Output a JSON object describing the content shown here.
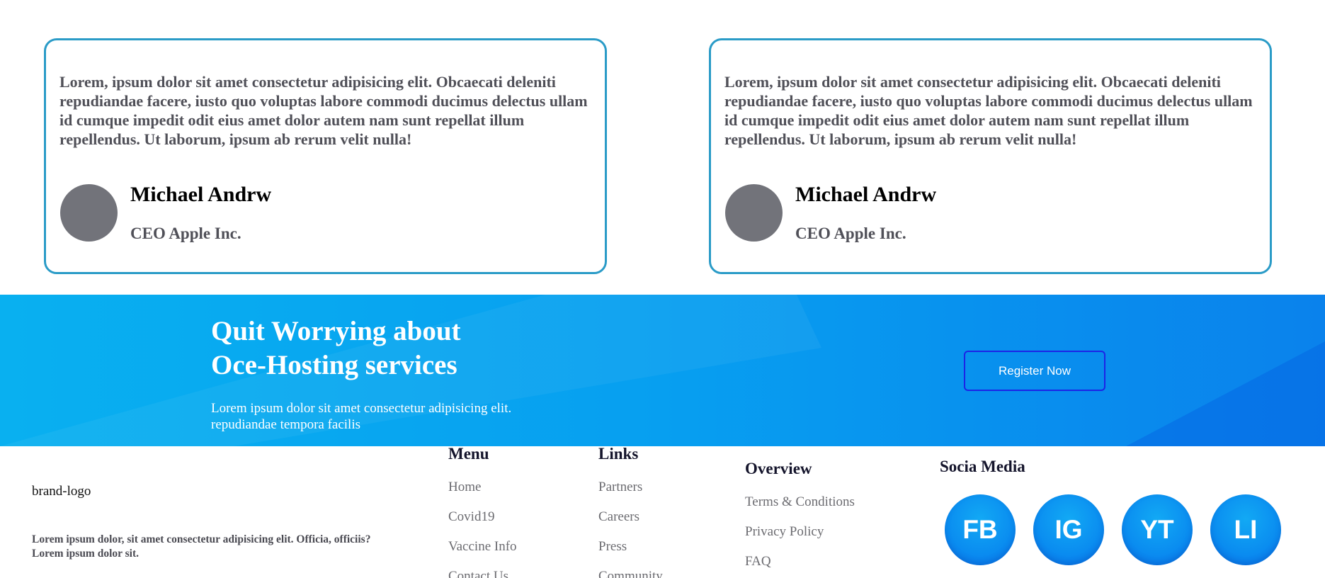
{
  "testimonials": [
    {
      "text": "Lorem, ipsum dolor sit amet consectetur adipisicing elit. Obcaecati deleniti repudiandae facere, iusto quo voluptas labore commodi ducimus delectus ullam id cumque impedit odit eius amet dolor autem nam sunt repellat illum repellendus. Ut laborum, ipsum ab rerum velit nulla!",
      "name": "Michael Andrw",
      "role": "CEO Apple Inc."
    },
    {
      "text": "Lorem, ipsum dolor sit amet consectetur adipisicing elit. Obcaecati deleniti repudiandae facere, iusto quo voluptas labore commodi ducimus delectus ullam id cumque impedit odit eius amet dolor autem nam sunt repellat illum repellendus. Ut laborum, ipsum ab rerum velit nulla!",
      "name": "Michael Andrw",
      "role": "CEO Apple Inc."
    }
  ],
  "banner": {
    "title_line1": "Quit Worrying about",
    "title_line2": "Oce-Hosting services",
    "text_line1": "Lorem ipsum dolor sit amet consectetur adipisicing elit.",
    "text_line2": "repudiandae tempora facilis",
    "button_label": "Register Now"
  },
  "footer": {
    "brand_logo_alt": "brand-logo",
    "about": "Lorem ipsum dolor, sit amet consectetur adipisicing elit. Officia, officiis? Lorem ipsum dolor sit.",
    "menu": {
      "title": "Menu",
      "items": [
        "Home",
        "Covid19",
        "Vaccine Info",
        "Contact Us"
      ]
    },
    "links": {
      "title": "Links",
      "items": [
        "Partners",
        "Careers",
        "Press",
        "Community"
      ]
    },
    "overview": {
      "title": "Overview",
      "items": [
        "Terms & Conditions",
        "Privacy Policy",
        "FAQ"
      ]
    },
    "social": {
      "title": "Socia Media",
      "items": [
        "FB",
        "IG",
        "YT",
        "LI"
      ]
    }
  },
  "colors": {
    "card_border": "#2a9bc7",
    "banner_start": "#09b0f0",
    "banner_end": "#0a82ec",
    "register_border": "#1c24e6",
    "avatar": "#72737a"
  }
}
